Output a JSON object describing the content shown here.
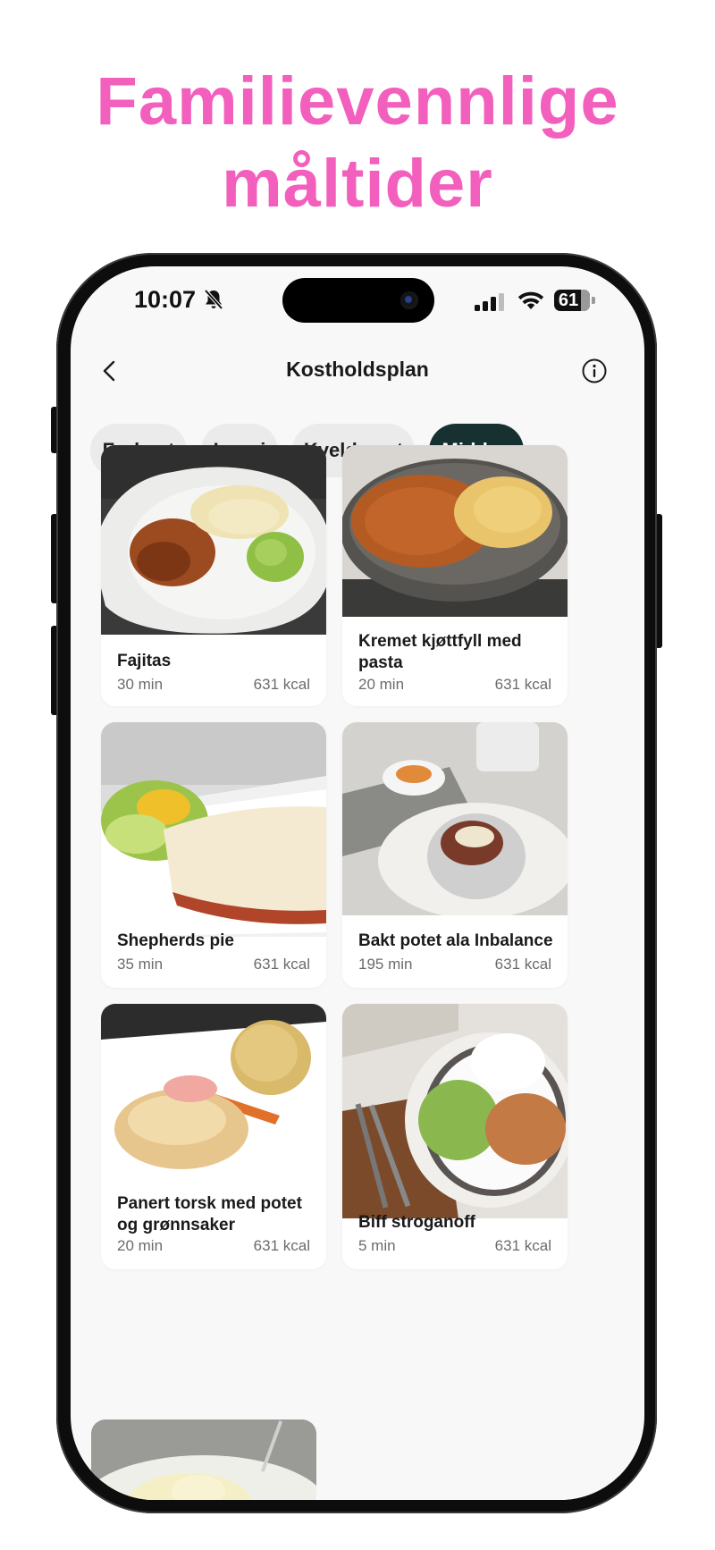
{
  "headline": {
    "line1": "Familievennlige",
    "line2": "måltider"
  },
  "status_bar": {
    "time": "10:07",
    "battery": "61"
  },
  "nav": {
    "title": "Kostholdsplan"
  },
  "tabs": [
    {
      "label": "Frokost",
      "active": false
    },
    {
      "label": "Lunsj",
      "active": false
    },
    {
      "label": "Kveldsmat",
      "active": false
    },
    {
      "label": "Middag",
      "active": true
    }
  ],
  "recipes": [
    {
      "name": "Fajitas",
      "time": "30 min",
      "kcal": "631 kcal"
    },
    {
      "name": "Kremet kjøttfyll med pasta",
      "time": "20 min",
      "kcal": "631 kcal"
    },
    {
      "name": "Shepherds pie",
      "time": "35 min",
      "kcal": "631 kcal"
    },
    {
      "name": "Bakt potet ala Inbalance",
      "time": "195 min",
      "kcal": "631 kcal"
    },
    {
      "name": "Panert torsk med potet og grønnsaker",
      "time": "20 min",
      "kcal": "631 kcal"
    },
    {
      "name": "Biff stroganoff",
      "time": "5 min",
      "kcal": "631 kcal"
    }
  ],
  "colors": {
    "headline": "#f25fbd",
    "active_tab": "#173030",
    "tab": "#ebebeb",
    "background": "#f8f8f8"
  }
}
